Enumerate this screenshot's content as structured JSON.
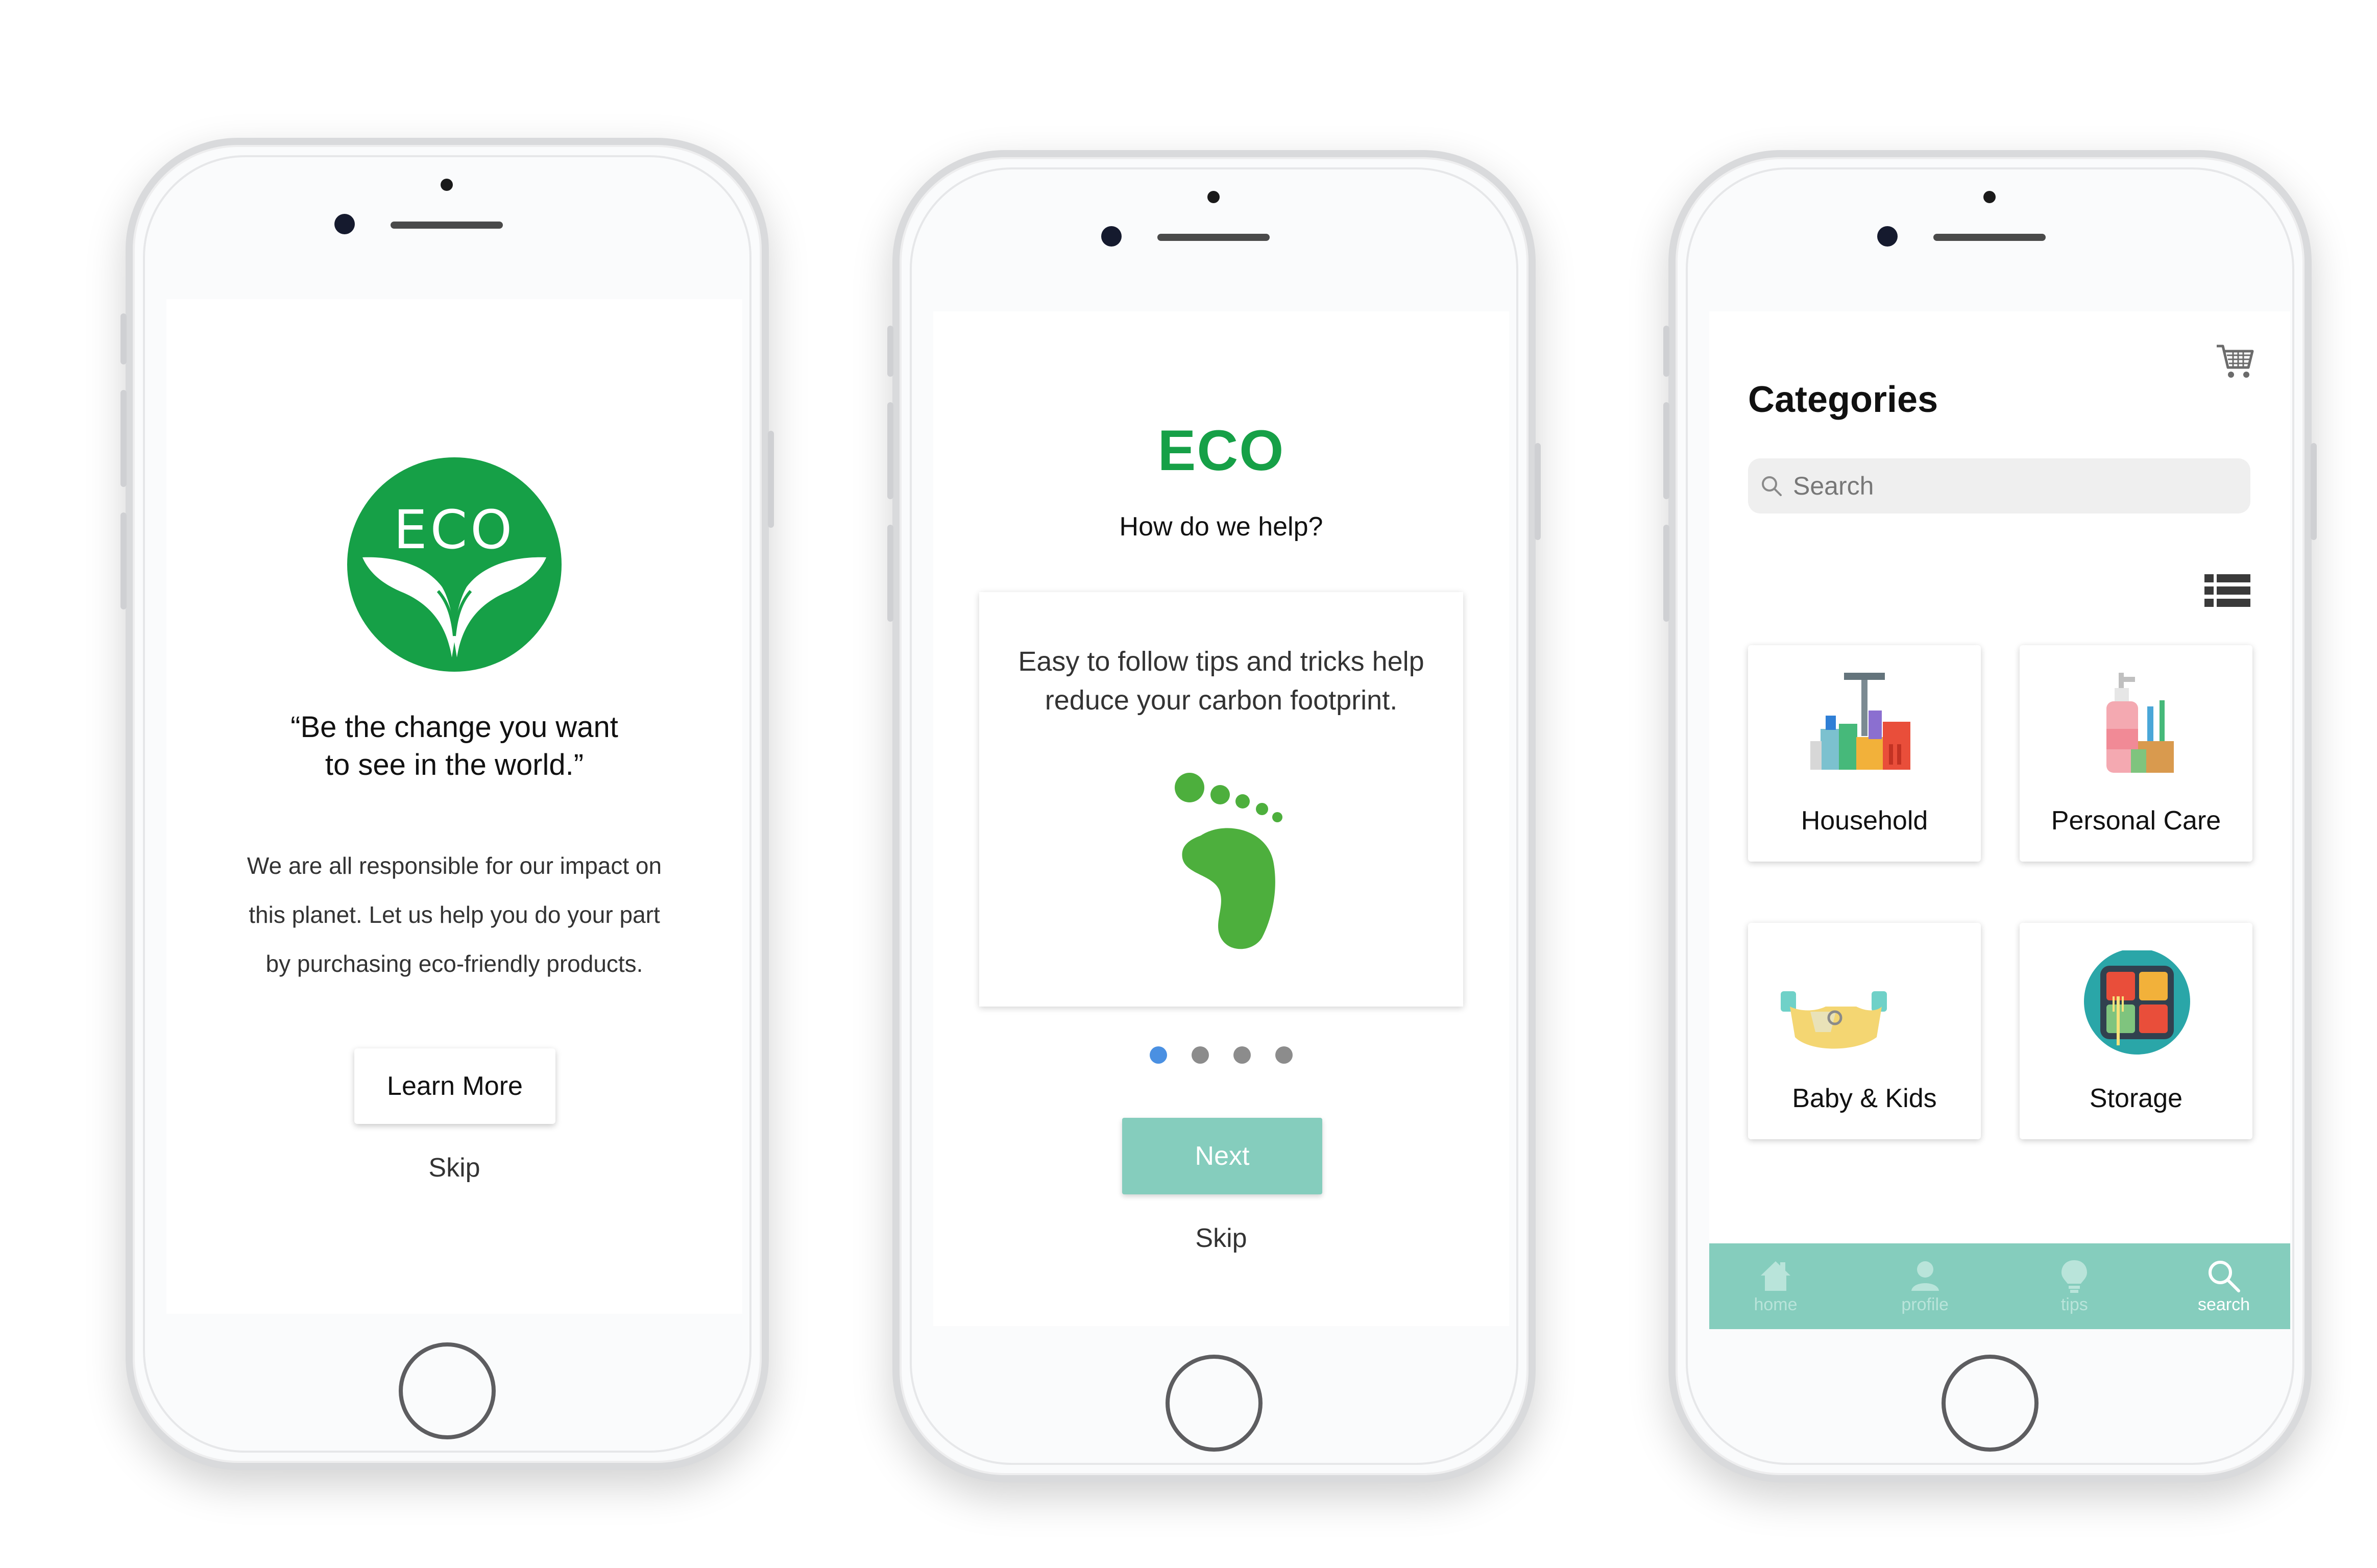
{
  "colors": {
    "eco_green": "#16a047",
    "footprint_green": "#4daf3d",
    "accent_teal": "#85cdbd",
    "active_dot": "#4a90e2"
  },
  "phone1": {
    "logo_text": "ECO",
    "quote": [
      "“Be the change you want",
      "to see in the world.”"
    ],
    "body": [
      "We are all responsible for our impact on",
      "this planet. Let us help you do your part",
      "by purchasing eco-friendly products."
    ],
    "learn_more": "Learn More",
    "skip": "Skip"
  },
  "phone2": {
    "title": "ECO",
    "subtitle": "How do we help?",
    "card_text": [
      "Easy to follow tips and tricks help",
      "reduce your carbon footprint."
    ],
    "card_icon": "footprint-icon",
    "pager": {
      "total": 4,
      "active_index": 0
    },
    "next": "Next",
    "skip": "Skip"
  },
  "phone3": {
    "title": "Categories",
    "search_placeholder": "Search",
    "icons": {
      "cart": "shopping-cart-icon",
      "list": "list-view-icon",
      "search": "search-icon"
    },
    "categories": [
      {
        "label": "Household",
        "icon": "cleaning-supplies-icon"
      },
      {
        "label": "Personal Care",
        "icon": "toiletries-icon"
      },
      {
        "label": "Baby & Kids",
        "icon": "diaper-bottle-icon"
      },
      {
        "label": "Storage",
        "icon": "lunchbox-icon"
      }
    ],
    "tabs": [
      {
        "label": "home",
        "icon": "home-icon"
      },
      {
        "label": "profile",
        "icon": "profile-icon"
      },
      {
        "label": "tips",
        "icon": "lightbulb-icon"
      },
      {
        "label": "search",
        "icon": "search-icon",
        "active": true
      }
    ]
  }
}
